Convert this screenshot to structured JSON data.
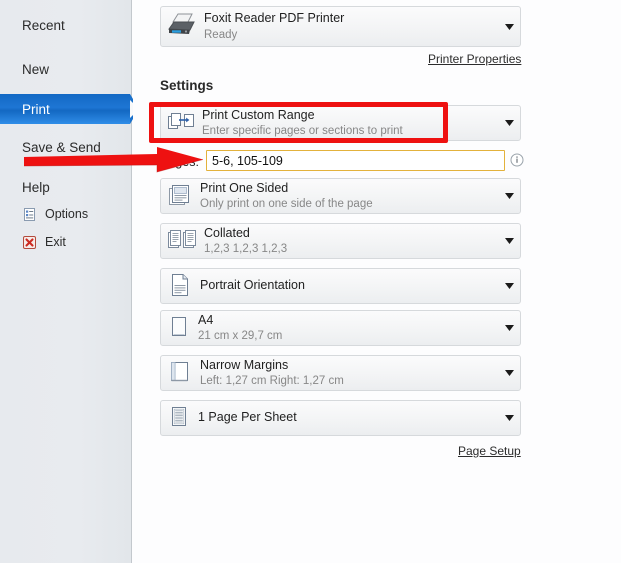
{
  "app": {
    "accent_blue": "#1e76d4",
    "highlight_red": "#ee1111",
    "input_border": "#e3b23c"
  },
  "sidebar": {
    "items": [
      {
        "label": "Recent",
        "selected": false,
        "icon": null
      },
      {
        "label": "New",
        "selected": false,
        "icon": null
      },
      {
        "label": "Print",
        "selected": true,
        "icon": null
      },
      {
        "label": "Save & Send",
        "selected": false,
        "icon": null
      },
      {
        "label": "Help",
        "selected": false,
        "icon": null
      }
    ],
    "small_items": [
      {
        "label": "Options",
        "icon": "options-document-icon"
      },
      {
        "label": "Exit",
        "icon": "exit-red-x-icon"
      }
    ]
  },
  "printer": {
    "name": "Foxit Reader PDF Printer",
    "status": "Ready",
    "icon": "printer-icon",
    "properties_link": "Printer Properties"
  },
  "settings": {
    "heading": "Settings",
    "rows": [
      {
        "id": "print-range",
        "title": "Print Custom Range",
        "subtitle": "Enter specific pages or sections to print",
        "icon": "custom-range-icon",
        "highlighted": true
      },
      {
        "id": "sides",
        "title": "Print One Sided",
        "subtitle": "Only print on one side of the page",
        "icon": "one-sided-icon",
        "highlighted": false
      },
      {
        "id": "collation",
        "title": "Collated",
        "subtitle": "1,2,3   1,2,3   1,2,3",
        "icon": "collated-icon",
        "highlighted": false
      },
      {
        "id": "orientation",
        "title": "Portrait Orientation",
        "subtitle": "",
        "icon": "portrait-icon",
        "highlighted": false
      },
      {
        "id": "paper-size",
        "title": "A4",
        "subtitle": "21 cm x 29,7 cm",
        "icon": "paper-size-icon",
        "highlighted": false
      },
      {
        "id": "margins",
        "title": "Narrow Margins",
        "subtitle": "Left:  1,27 cm    Right:  1,27 cm",
        "icon": "margins-icon",
        "highlighted": false
      },
      {
        "id": "pages-per-sheet",
        "title": "1 Page Per Sheet",
        "subtitle": "",
        "icon": "pages-per-sheet-icon",
        "highlighted": false
      }
    ],
    "pages_field": {
      "label": "Pages:",
      "value": "5-6, 105-109",
      "placeholder": "",
      "info_icon": "info-icon"
    },
    "page_setup_link": "Page Setup"
  },
  "annotations": {
    "red_rectangle_target": "Print Custom Range",
    "red_arrow_target": "Pages field"
  }
}
